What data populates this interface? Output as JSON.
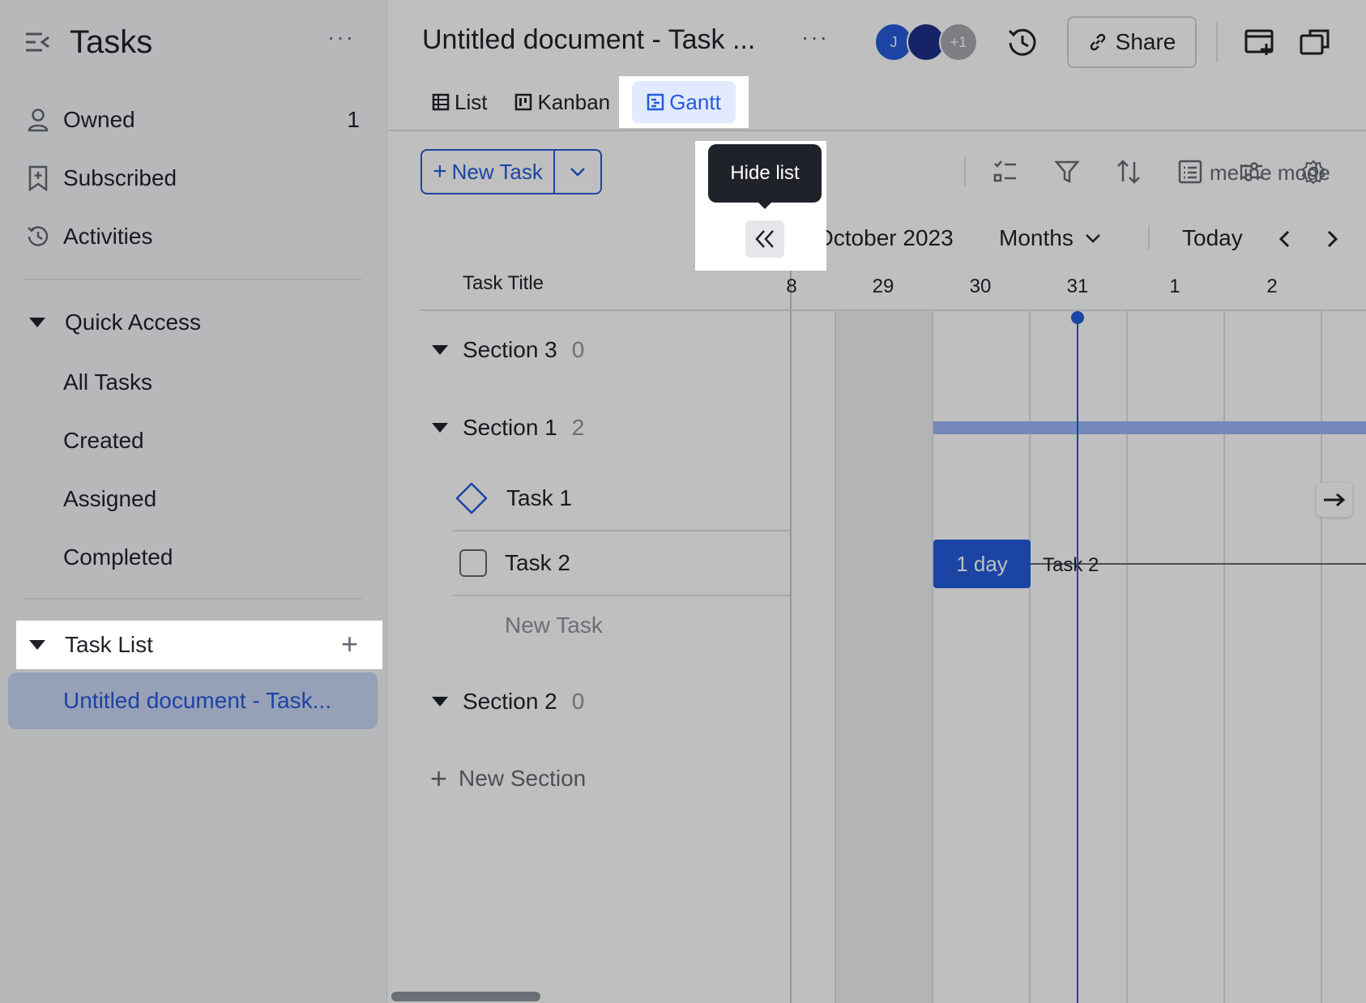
{
  "sidebar": {
    "title": "Tasks",
    "more": "···",
    "items": [
      {
        "label": "Owned",
        "count": "1",
        "icon": "user-icon"
      },
      {
        "label": "Subscribed",
        "icon": "bookmark-icon"
      },
      {
        "label": "Activities",
        "icon": "history-icon"
      }
    ],
    "quick_access": {
      "label": "Quick Access",
      "items": [
        "All Tasks",
        "Created",
        "Assigned",
        "Completed"
      ]
    },
    "task_list": {
      "label": "Task List",
      "add": "+",
      "items": [
        "Untitled document - Task..."
      ]
    }
  },
  "header": {
    "doc_title": "Untitled document - Task ...",
    "more": "···",
    "avatars": [
      {
        "initial": "J",
        "color": "#245bdb"
      },
      {
        "initial": "",
        "color": "#1e2f8a"
      },
      {
        "initial": "+1",
        "color": "#a6a9ad"
      }
    ],
    "share_label": "Share"
  },
  "tabs": [
    {
      "label": "List",
      "icon": "table-icon"
    },
    {
      "label": "Kanban",
      "icon": "kanban-icon"
    },
    {
      "label": "Gantt",
      "icon": "gantt-icon",
      "active": true
    }
  ],
  "toolbar": {
    "new_task_label": "New Task",
    "timeline_mode_label": "meline mode",
    "tooltip": "Hide list"
  },
  "timeline": {
    "month_label": "October 2023",
    "scale_label": "Months",
    "today_label": "Today",
    "days": [
      "8",
      "29",
      "30",
      "31",
      "1",
      "2"
    ]
  },
  "list": {
    "title_header": "Task Title",
    "sections": [
      {
        "name": "Section 3",
        "count": "0"
      },
      {
        "name": "Section 1",
        "count": "2"
      },
      {
        "name": "Section 2",
        "count": "0"
      }
    ],
    "tasks": [
      {
        "name": "Task 1",
        "type": "milestone"
      },
      {
        "name": "Task 2",
        "type": "task"
      }
    ],
    "new_task_placeholder": "New Task",
    "new_section_label": "New Section"
  },
  "gantt": {
    "task_bar_label": "1 day",
    "task_bar_name": "Task 2"
  },
  "colors": {
    "accent": "#245bdb",
    "accent_light": "#e1eaff",
    "section_bar": "#9db6f7"
  }
}
